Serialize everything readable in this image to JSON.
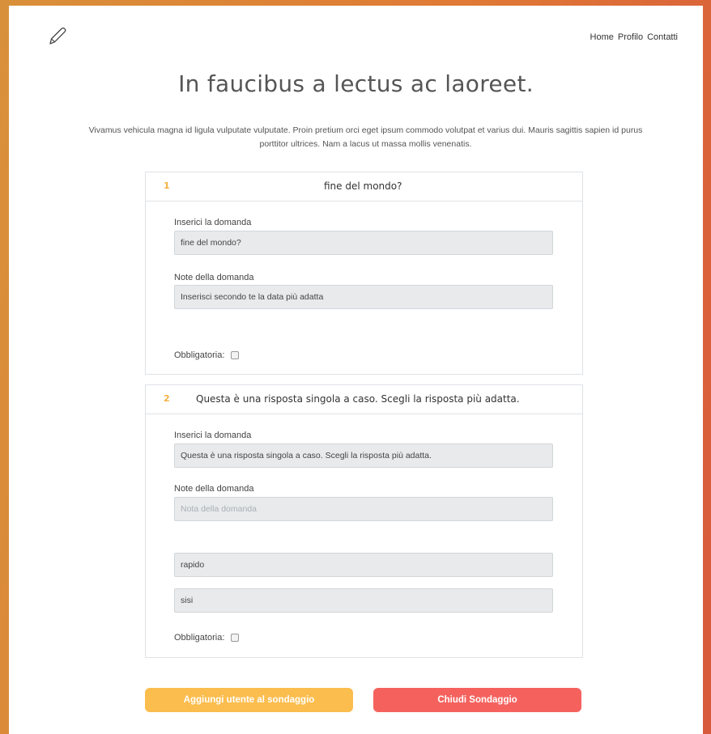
{
  "nav": {
    "items": [
      "Home",
      "Profilo",
      "Contatti"
    ]
  },
  "header": {
    "title": "In faucibus a lectus ac laoreet."
  },
  "intro": {
    "line1": "Vivamus vehicula magna id ligula vulputate vulputate. Proin pretium orci eget ipsum commodo volutpat et varius dui. Mauris sagittis sapien id purus",
    "line2": "porttitor ultrices. Nam a lacus ut massa mollis venenatis."
  },
  "questions": [
    {
      "number": "1",
      "title": "fine del mondo?",
      "question_label": "Inserici la domanda",
      "question_value": "fine del mondo?",
      "notes_label": "Note della domanda",
      "notes_value": "Inserisci secondo te la data più adatta",
      "mandatory_label": "Obbligatoria:"
    },
    {
      "number": "2",
      "title": "Questa è una risposta singola a caso. Scegli la risposta più adatta.",
      "question_label": "Inserici la domanda",
      "question_value": "Questa è una risposta singola a caso. Scegli la risposta più adatta.",
      "notes_label": "Note della domanda",
      "notes_placeholder": "Nota della domanda",
      "answers": [
        "rapido",
        "sisi"
      ],
      "mandatory_label": "Obbligatoria:"
    }
  ],
  "buttons": {
    "add_user": "Aggiungi utente al sondaggio",
    "close_survey": "Chiudi Sondaggio"
  },
  "colors": {
    "accent_orange": "#fbbd4e",
    "accent_red": "#f5625e",
    "question_number": "#f5b041"
  }
}
